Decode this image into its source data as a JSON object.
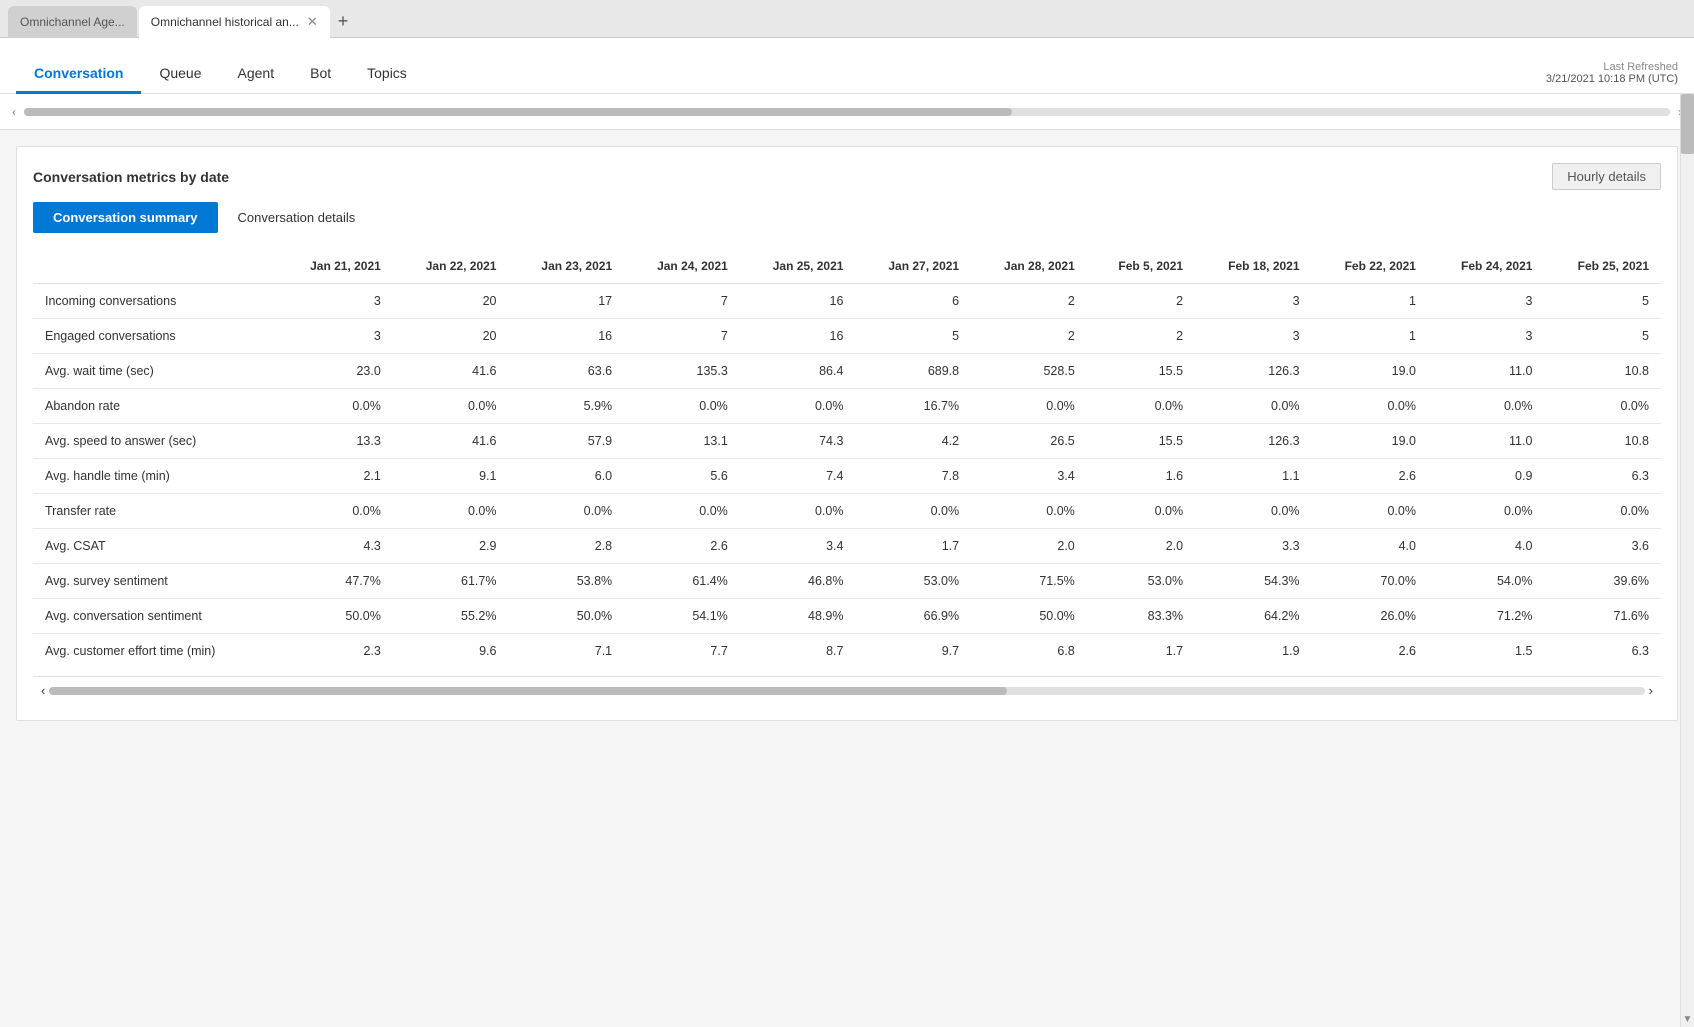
{
  "browser": {
    "tabs": [
      {
        "id": "tab1",
        "label": "Omnichannel Age...",
        "active": false
      },
      {
        "id": "tab2",
        "label": "Omnichannel historical an...",
        "active": true
      }
    ],
    "add_tab_label": "+"
  },
  "header": {
    "nav_items": [
      {
        "id": "conversation",
        "label": "Conversation",
        "active": true
      },
      {
        "id": "queue",
        "label": "Queue",
        "active": false
      },
      {
        "id": "agent",
        "label": "Agent",
        "active": false
      },
      {
        "id": "bot",
        "label": "Bot",
        "active": false
      },
      {
        "id": "topics",
        "label": "Topics",
        "active": false
      }
    ],
    "last_refreshed_label": "Last Refreshed",
    "last_refreshed_value": "3/21/2021 10:18 PM (UTC)"
  },
  "card": {
    "title": "Conversation metrics by date",
    "hourly_details_label": "Hourly details",
    "sub_tabs": [
      {
        "id": "summary",
        "label": "Conversation summary",
        "active": true
      },
      {
        "id": "details",
        "label": "Conversation details",
        "active": false
      }
    ],
    "table": {
      "columns": [
        "",
        "Jan 21, 2021",
        "Jan 22, 2021",
        "Jan 23, 2021",
        "Jan 24, 2021",
        "Jan 25, 2021",
        "Jan 27, 2021",
        "Jan 28, 2021",
        "Feb 5, 2021",
        "Feb 18, 2021",
        "Feb 22, 2021",
        "Feb 24, 2021",
        "Feb 25, 2021"
      ],
      "rows": [
        {
          "label": "Incoming conversations",
          "values": [
            "3",
            "20",
            "17",
            "7",
            "16",
            "6",
            "2",
            "2",
            "3",
            "1",
            "3",
            "5"
          ]
        },
        {
          "label": "Engaged conversations",
          "values": [
            "3",
            "20",
            "16",
            "7",
            "16",
            "5",
            "2",
            "2",
            "3",
            "1",
            "3",
            "5"
          ]
        },
        {
          "label": "Avg. wait time (sec)",
          "values": [
            "23.0",
            "41.6",
            "63.6",
            "135.3",
            "86.4",
            "689.8",
            "528.5",
            "15.5",
            "126.3",
            "19.0",
            "11.0",
            "10.8"
          ]
        },
        {
          "label": "Abandon rate",
          "values": [
            "0.0%",
            "0.0%",
            "5.9%",
            "0.0%",
            "0.0%",
            "16.7%",
            "0.0%",
            "0.0%",
            "0.0%",
            "0.0%",
            "0.0%",
            "0.0%"
          ]
        },
        {
          "label": "Avg. speed to answer (sec)",
          "values": [
            "13.3",
            "41.6",
            "57.9",
            "13.1",
            "74.3",
            "4.2",
            "26.5",
            "15.5",
            "126.3",
            "19.0",
            "11.0",
            "10.8"
          ]
        },
        {
          "label": "Avg. handle time (min)",
          "values": [
            "2.1",
            "9.1",
            "6.0",
            "5.6",
            "7.4",
            "7.8",
            "3.4",
            "1.6",
            "1.1",
            "2.6",
            "0.9",
            "6.3"
          ]
        },
        {
          "label": "Transfer rate",
          "values": [
            "0.0%",
            "0.0%",
            "0.0%",
            "0.0%",
            "0.0%",
            "0.0%",
            "0.0%",
            "0.0%",
            "0.0%",
            "0.0%",
            "0.0%",
            "0.0%"
          ]
        },
        {
          "label": "Avg. CSAT",
          "values": [
            "4.3",
            "2.9",
            "2.8",
            "2.6",
            "3.4",
            "1.7",
            "2.0",
            "2.0",
            "3.3",
            "4.0",
            "4.0",
            "3.6"
          ]
        },
        {
          "label": "Avg. survey sentiment",
          "values": [
            "47.7%",
            "61.7%",
            "53.8%",
            "61.4%",
            "46.8%",
            "53.0%",
            "71.5%",
            "53.0%",
            "54.3%",
            "70.0%",
            "54.0%",
            "39.6%"
          ]
        },
        {
          "label": "Avg. conversation sentiment",
          "values": [
            "50.0%",
            "55.2%",
            "50.0%",
            "54.1%",
            "48.9%",
            "66.9%",
            "50.0%",
            "83.3%",
            "64.2%",
            "26.0%",
            "71.2%",
            "71.6%"
          ]
        },
        {
          "label": "Avg. customer effort time (min)",
          "values": [
            "2.3",
            "9.6",
            "7.1",
            "7.7",
            "8.7",
            "9.7",
            "6.8",
            "1.7",
            "1.9",
            "2.6",
            "1.5",
            "6.3"
          ]
        }
      ]
    }
  }
}
